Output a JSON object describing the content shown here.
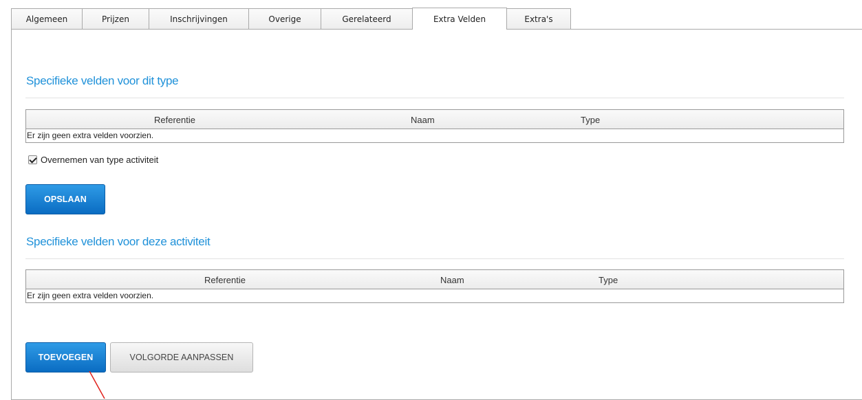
{
  "tabs": [
    {
      "label": "Algemeen"
    },
    {
      "label": "Prijzen"
    },
    {
      "label": "Inschrijvingen"
    },
    {
      "label": "Overige"
    },
    {
      "label": "Gerelateerd"
    },
    {
      "label": "Extra Velden",
      "active": true
    },
    {
      "label": "Extra's"
    }
  ],
  "type_section": {
    "title": "Specifieke velden voor dit type",
    "columns": [
      "Referentie",
      "Naam",
      "Type"
    ],
    "empty_message": "Er zijn geen extra velden voorzien.",
    "inherit_checkbox": {
      "label": "Overnemen van type activiteit",
      "checked": true
    },
    "save_label": "OPSLAAN"
  },
  "activity_section": {
    "title": "Specifieke velden voor deze activiteit",
    "columns": [
      "Referentie",
      "Naam",
      "Type"
    ],
    "empty_message": "Er zijn geen extra velden voorzien.",
    "add_label": "TOEVOEGEN",
    "reorder_label": "VOLGORDE AANPASSEN"
  },
  "colors": {
    "accent": "#1f91d9",
    "primary_button": "#0a6cc2",
    "annotation": "#e0201b"
  }
}
